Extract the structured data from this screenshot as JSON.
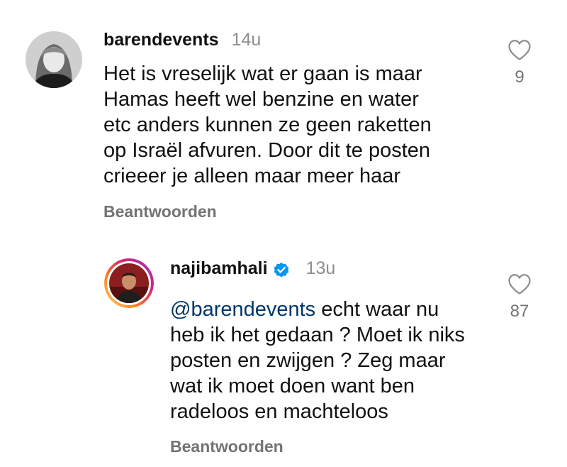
{
  "comments": [
    {
      "username": "barendevents",
      "time": "14u",
      "verified": false,
      "lines": [
        "Het is vreselijk wat er gaan is maar",
        "Hamas heeft wel benzine en water",
        "etc anders kunnen ze geen raketten",
        "op Israël afvuren. Door dit te posten",
        "crieeer je alleen maar meer haar"
      ],
      "reply_label": "Beantwoorden",
      "like_count": "9",
      "like_icon": "heart-outline-icon"
    },
    {
      "username": "najibamhali",
      "time": "13u",
      "verified": true,
      "mention": "@barendevents",
      "lines": [
        "echt waar nu",
        "heb ik het gedaan ? Moet ik niks",
        "posten en zwijgen ? Zeg maar",
        "wat ik moet doen want ben",
        "radeloos en machteloos"
      ],
      "reply_label": "Beantwoorden",
      "like_count": "87",
      "like_icon": "heart-outline-icon"
    }
  ],
  "colors": {
    "text": "#111111",
    "secondary": "#737373",
    "mention": "#00376b",
    "verified": "#0095f6"
  }
}
